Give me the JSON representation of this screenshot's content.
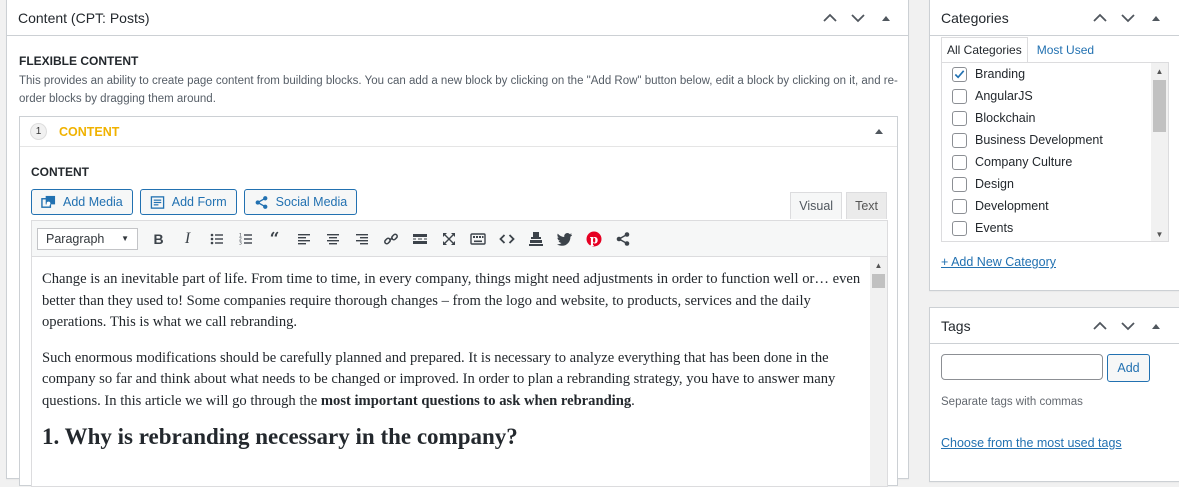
{
  "main_box": {
    "title": "Content (CPT: Posts)",
    "field_label": "FLEXIBLE CONTENT",
    "field_desc": "This provides an ability to create page content from building blocks. You can add a new block by clicking on the \"Add Row\" button below, edit a block by clicking on it, and re-order blocks by dragging them around.",
    "layout": {
      "order": "1",
      "name": "CONTENT",
      "content_label": "CONTENT",
      "buttons": {
        "add_media": "Add Media",
        "add_form": "Add Form",
        "social_media": "Social Media"
      },
      "tabs": {
        "visual": "Visual",
        "text": "Text"
      },
      "format_select": "Paragraph",
      "body": {
        "p1": "Change is an inevitable part of life. From time to time, in every company, things might need adjustments in order to function well or… even better than they used to! Some companies require thorough changes – from the logo and website, to products, services and the daily operations. This is what we call rebranding.",
        "p2_start": "Such enormous modifications should be carefully planned and prepared. It is necessary to analyze everything that has been done in the company so far and think about what needs to be changed or improved. In order to plan a rebranding strategy, you have to answer many questions. In this article we will go through the ",
        "p2_bold": "most important questions to ask when rebranding",
        "p2_end": ".",
        "h2": "1. Why is rebranding necessary in the company?"
      }
    }
  },
  "categories_box": {
    "title": "Categories",
    "tab_all": "All Categories",
    "tab_most_used": "Most Used",
    "items": [
      {
        "label": "Branding",
        "checked": true
      },
      {
        "label": "AngularJS",
        "checked": false
      },
      {
        "label": "Blockchain",
        "checked": false
      },
      {
        "label": "Business Development",
        "checked": false
      },
      {
        "label": "Company Culture",
        "checked": false
      },
      {
        "label": "Design",
        "checked": false
      },
      {
        "label": "Development",
        "checked": false
      },
      {
        "label": "Events",
        "checked": false
      }
    ],
    "add_new": "+ Add New Category"
  },
  "tags_box": {
    "title": "Tags",
    "add_button": "Add",
    "help": "Separate tags with commas",
    "choose_link": "Choose from the most used tags"
  },
  "colors": {
    "accent": "#2271b1",
    "layout_title": "#f0b200",
    "pinterest": "#e60023"
  }
}
